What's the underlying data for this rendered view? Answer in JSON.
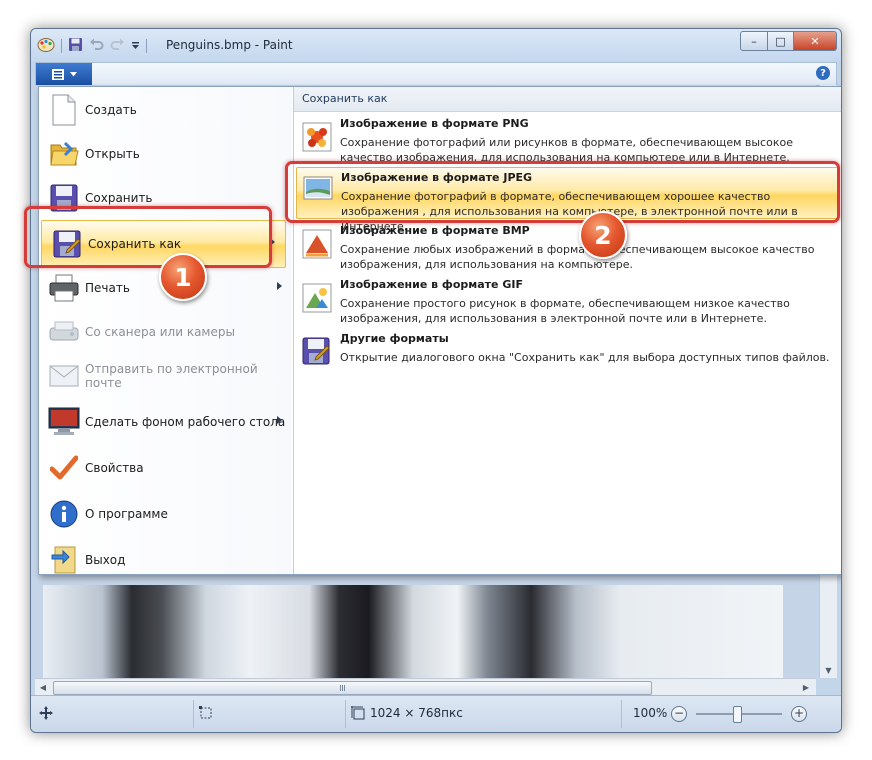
{
  "window": {
    "title": "Penguins.bmp - Paint",
    "controls": {
      "minimize": "–",
      "maximize": "□",
      "close": "✕"
    }
  },
  "ribbon": {
    "help_label": "?"
  },
  "file_menu": {
    "items": [
      {
        "label": "Создать",
        "icon": "new-document-icon",
        "disabled": false,
        "submenu": false
      },
      {
        "label": "Открыть",
        "icon": "open-folder-icon",
        "disabled": false,
        "submenu": false
      },
      {
        "label": "Сохранить",
        "icon": "save-disk-icon",
        "disabled": false,
        "submenu": false
      },
      {
        "label": "Сохранить как",
        "icon": "save-as-icon",
        "disabled": false,
        "submenu": true,
        "highlighted": true
      },
      {
        "label": "Печать",
        "icon": "printer-icon",
        "disabled": false,
        "submenu": true
      },
      {
        "label": "Со сканера или камеры",
        "icon": "scanner-icon",
        "disabled": true,
        "submenu": false
      },
      {
        "label": "Отправить по электронной почте",
        "icon": "email-icon",
        "disabled": true,
        "submenu": false
      },
      {
        "label": "Сделать фоном рабочего стола",
        "icon": "desktop-background-icon",
        "disabled": false,
        "submenu": true
      },
      {
        "label": "Свойства",
        "icon": "checkmark-icon",
        "disabled": false,
        "submenu": false
      },
      {
        "label": "О программе",
        "icon": "info-icon",
        "disabled": false,
        "submenu": false
      },
      {
        "label": "Выход",
        "icon": "exit-icon",
        "disabled": false,
        "submenu": false
      }
    ]
  },
  "save_as_panel": {
    "header": "Сохранить как",
    "formats": [
      {
        "title": "Изображение в формате PNG",
        "desc": "Сохранение фотографий или рисунков в формате, обеспечивающем высокое качество изображения, для использования на компьютере или в Интернете.",
        "icon": "png-image-icon"
      },
      {
        "title": "Изображение в формате JPEG",
        "desc": "Сохранение фотографий в формате, обеспечивающем хорошее качество изображения , для использования на компьютере, в электронной почте или в Интернете.",
        "icon": "jpeg-image-icon",
        "highlighted": true
      },
      {
        "title": "Изображение в формате BMP",
        "desc": "Сохранение любых изображений в формате, обеспечивающем высокое качество изображения, для использования на компьютере.",
        "icon": "bmp-image-icon"
      },
      {
        "title": "Изображение в формате GIF",
        "desc": "Сохранение простого рисунок в формате, обеспечивающем низкое качество изображения, для использования в электронной почте или в Интернете.",
        "icon": "gif-image-icon"
      },
      {
        "title": "Другие форматы",
        "desc": "Открытие диалогового окна \"Сохранить как\" для выбора доступных типов файлов.",
        "icon": "other-formats-icon"
      }
    ]
  },
  "callouts": {
    "step1": "1",
    "step2": "2"
  },
  "statusbar": {
    "dimensions": "1024 × 768пкс",
    "zoom": "100%",
    "zoom_minus": "−",
    "zoom_plus": "+"
  },
  "colors": {
    "accent": "#1a4fa3",
    "highlight": "#ffd764",
    "callout": "#e5582f",
    "ring": "#d43d3a"
  }
}
